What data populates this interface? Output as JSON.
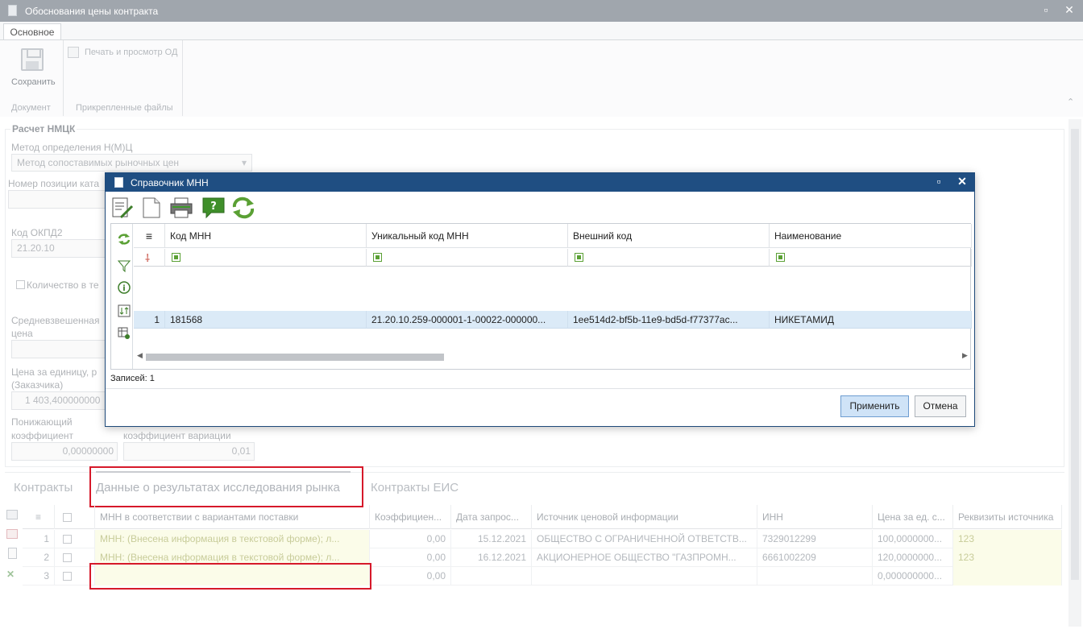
{
  "window": {
    "title": "Обоснования цены контракта"
  },
  "ribbon": {
    "tab": "Основное",
    "save_label": "Сохранить",
    "print_label": "Печать и просмотр ОД",
    "group_document": "Документ",
    "group_files": "Прикрепленные файлы"
  },
  "form": {
    "group_title": "Расчет НМЦК",
    "method_label": "Метод определения Н(М)Ц",
    "method_value": "Метод сопоставимых рыночных цен",
    "position_label": "Номер позиции ката",
    "okpd_label": "Код ОКПД2",
    "okpd_value": "21.20.10",
    "quantity_label": "Количество в те",
    "avg_price_label_1": "Средневзвешенная",
    "avg_price_label_2": "цена",
    "unit_price_label_1": "Цена за единицу, р",
    "unit_price_label_2": "(Заказчика)",
    "unit_price_value": "1 403,400000000",
    "reducing_label_1": "Понижающий",
    "reducing_label_2": "коэффициент",
    "reducing_value": "0,00000000",
    "variation_label": "коэффициент вариации",
    "variation_value": "0,01"
  },
  "bottom_tabs": {
    "contracts": "Контракты",
    "market": "Данные о результатах исследования рынка",
    "eis": "Контракты ЕИС"
  },
  "market_grid": {
    "columns": [
      "МНН в соответствии с вариантами поставки",
      "Коэффициен...",
      "Дата запрос...",
      "Источник ценовой информации",
      "ИНН",
      "Цена за ед. с...",
      "Реквизиты источника"
    ],
    "rows": [
      {
        "n": "1",
        "mnn": "МНН: (Внесена информация в текстовой форме); л...",
        "coef": "0,00",
        "date": "15.12.2021",
        "source": "ОБЩЕСТВО С ОГРАНИЧЕННОЙ ОТВЕТСТВ...",
        "inn": "7329012299",
        "price": "100,0000000...",
        "req": "123"
      },
      {
        "n": "2",
        "mnn": "МНН: (Внесена информация в текстовой форме); л...",
        "coef": "0,00",
        "date": "16.12.2021",
        "source": "АКЦИОНЕРНОЕ ОБЩЕСТВО \"ГАЗПРОМН...",
        "inn": "6661002209",
        "price": "120,0000000...",
        "req": "123"
      },
      {
        "n": "3",
        "mnn": "",
        "coef": "0,00",
        "date": "",
        "source": "",
        "inn": "",
        "price": "0,000000000...",
        "req": ""
      }
    ]
  },
  "modal": {
    "title": "Справочник МНН",
    "columns": [
      "Код МНН",
      "Уникальный код МНН",
      "Внешний код",
      "Наименование"
    ],
    "rows": [
      {
        "n": "1",
        "code": "181568",
        "unique": "21.20.10.259-000001-1-00022-000000...",
        "external": "1ee514d2-bf5b-11e9-bd5d-f77377ac...",
        "name": "НИКЕТАМИД"
      }
    ],
    "records_label": "Записей: 1",
    "apply": "Применить",
    "cancel": "Отмена"
  },
  "colors": {
    "modal_title": "#1f4e82",
    "highlight": "#d6192a",
    "selected_row": "#dbeaf7"
  }
}
